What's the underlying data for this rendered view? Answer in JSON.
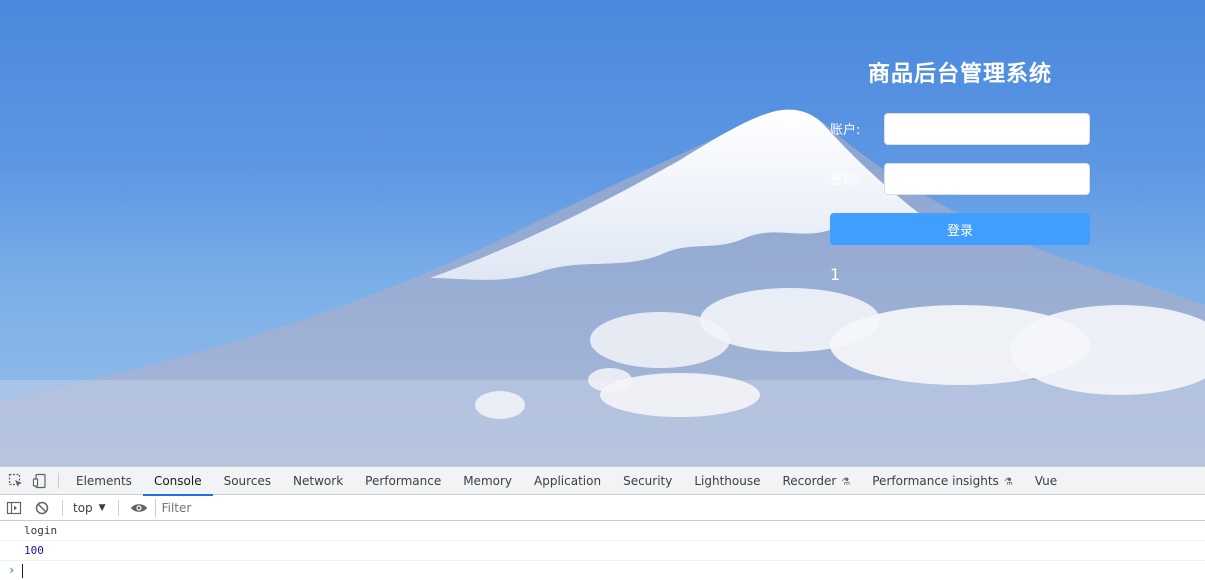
{
  "app": {
    "title": "商品后台管理系统",
    "account_label": "账户:",
    "account_value": "",
    "password_label": "密码:",
    "password_value": "",
    "login_button": "登录",
    "counter_value": "1"
  },
  "devtools": {
    "tabs": [
      {
        "label": "Elements"
      },
      {
        "label": "Console",
        "active": true
      },
      {
        "label": "Sources"
      },
      {
        "label": "Network"
      },
      {
        "label": "Performance"
      },
      {
        "label": "Memory"
      },
      {
        "label": "Application"
      },
      {
        "label": "Security"
      },
      {
        "label": "Lighthouse"
      },
      {
        "label": "Recorder",
        "experimental": true
      },
      {
        "label": "Performance insights",
        "experimental": true
      },
      {
        "label": "Vue"
      }
    ],
    "context": "top",
    "filter_placeholder": "Filter",
    "logs": [
      "login",
      "100"
    ]
  },
  "colors": {
    "accent": "#409eff",
    "devtools_active": "#1a73e8",
    "number_log": "#1a1aa6"
  },
  "icons": {
    "inspect": "inspect-element-icon",
    "device": "device-toolbar-icon",
    "sidebar": "console-sidebar-icon",
    "clear": "clear-console-icon",
    "eye": "live-expression-eye-icon",
    "flask": "experimental-flask-icon",
    "prompt": "console-prompt-chevron-icon"
  }
}
